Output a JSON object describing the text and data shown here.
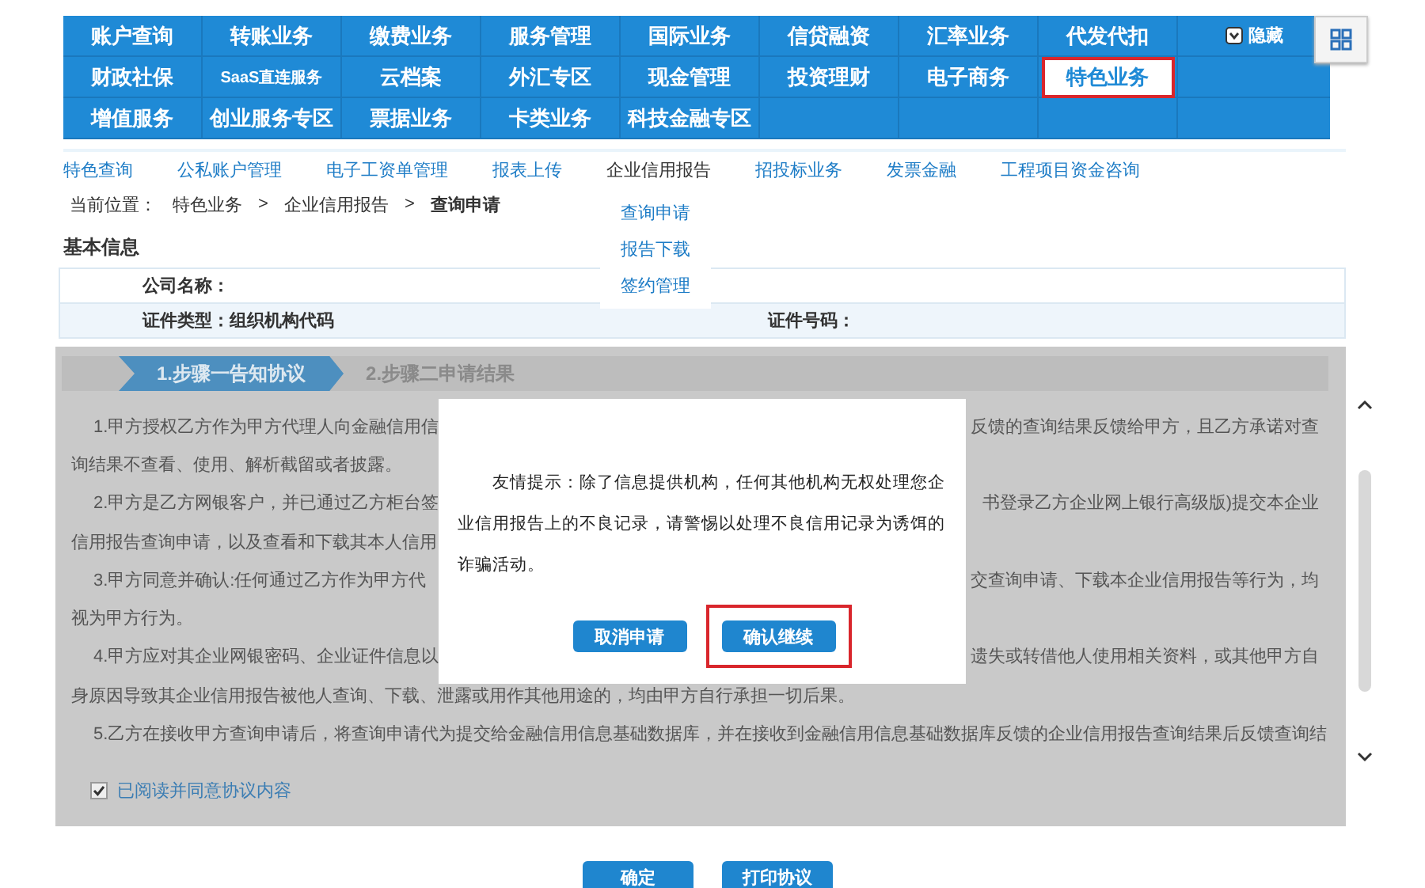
{
  "nav": {
    "rows": [
      [
        {
          "label": "账户查询",
          "selected": false
        },
        {
          "label": "转账业务",
          "selected": false
        },
        {
          "label": "缴费业务",
          "selected": false
        },
        {
          "label": "服务管理",
          "selected": false
        },
        {
          "label": "国际业务",
          "selected": false
        },
        {
          "label": "信贷融资",
          "selected": false
        },
        {
          "label": "汇率业务",
          "selected": false
        },
        {
          "label": "代发代扣",
          "selected": false
        }
      ],
      [
        {
          "label": "财政社保",
          "selected": false
        },
        {
          "label": "SaaS直连服务",
          "selected": false
        },
        {
          "label": "云档案",
          "selected": false
        },
        {
          "label": "外汇专区",
          "selected": false
        },
        {
          "label": "现金管理",
          "selected": false
        },
        {
          "label": "投资理财",
          "selected": false
        },
        {
          "label": "电子商务",
          "selected": false
        },
        {
          "label": "特色业务",
          "selected": true
        }
      ],
      [
        {
          "label": "增值服务",
          "selected": false
        },
        {
          "label": "创业服务专区",
          "selected": false
        },
        {
          "label": "票据业务",
          "selected": false
        },
        {
          "label": "卡类业务",
          "selected": false
        },
        {
          "label": "科技金融专区",
          "selected": false
        }
      ]
    ],
    "hide_button": "隐藏"
  },
  "submenu": [
    {
      "label": "特色查询",
      "expanded": false
    },
    {
      "label": "公私账户管理",
      "expanded": false
    },
    {
      "label": "电子工资单管理",
      "expanded": false
    },
    {
      "label": "报表上传",
      "expanded": false
    },
    {
      "label": "企业信用报告",
      "expanded": true,
      "children": [
        "查询申请",
        "报告下载",
        "签约管理"
      ]
    },
    {
      "label": "招投标业务",
      "expanded": false
    },
    {
      "label": "发票金融",
      "expanded": false
    },
    {
      "label": "工程项目资金咨询",
      "expanded": false
    }
  ],
  "breadcrumb": {
    "label": "当前位置：",
    "items": [
      "特色业务",
      "企业信用报告",
      "查询申请"
    ],
    "separator": ">"
  },
  "basic_info": {
    "title": "基本信息",
    "company_label": "公司名称：",
    "id_type": "证件类型：组织机构代码",
    "id_number_label": "证件号码："
  },
  "steps": [
    {
      "label": "1.步骤一告知协议",
      "selected": true
    },
    {
      "label": "2.步骤二申请结果",
      "selected": false
    }
  ],
  "agreement": [
    {
      "kind": "start",
      "left": "1.甲方授权乙方作为甲方代理人向金融信用信",
      "right": "反馈的查询结果反馈给甲方，且乙方承诺对查"
    },
    {
      "kind": "cont",
      "left": "询结果不查看、使用、解析截留或者披露。"
    },
    {
      "kind": "start",
      "left": "2.甲方是乙方网银客户，并已通过乙方柜台签",
      "right": "书登录乙方企业网上银行高级版)提交本企业"
    },
    {
      "kind": "cont",
      "left": "信用报告查询申请，以及查看和下载其本人信用"
    },
    {
      "kind": "start",
      "left": "3.甲方同意并确认:任何通过乙方作为甲方代",
      "right": "交查询申请、下载本企业信用报告等行为，均"
    },
    {
      "kind": "cont",
      "left": "视为甲方行为。"
    },
    {
      "kind": "start",
      "left": "4.甲方应对其企业网银密码、企业证件信息以",
      "right": "遗失或转借他人使用相关资料，或其他甲方自"
    },
    {
      "kind": "cont",
      "left": "身原因导致其企业信用报告被他人查询、下载、泄露或用作其他用途的，均由甲方自行承担一切后果。"
    },
    {
      "kind": "start",
      "left": "5.乙方在接收甲方查询申请后，将查询申请代为提交给金融信用信息基础数据库，并在接收到金融信用信息基础数据库反馈的企业信用报告查询结果后反馈查询结"
    }
  ],
  "agree_checkbox": {
    "label": "已阅读并同意协议内容",
    "checked": true
  },
  "dialog": {
    "message": "友情提示：除了信息提供机构，任何其他机构无权处理您企业信用报告上的不良记录，请警惕以处理不良信用记录为诱饵的诈骗活动。",
    "buttons": [
      {
        "label": "取消申请",
        "highlighted": false
      },
      {
        "label": "确认继续",
        "highlighted": true
      }
    ]
  },
  "buttons": [
    "确定",
    "打印协议"
  ]
}
